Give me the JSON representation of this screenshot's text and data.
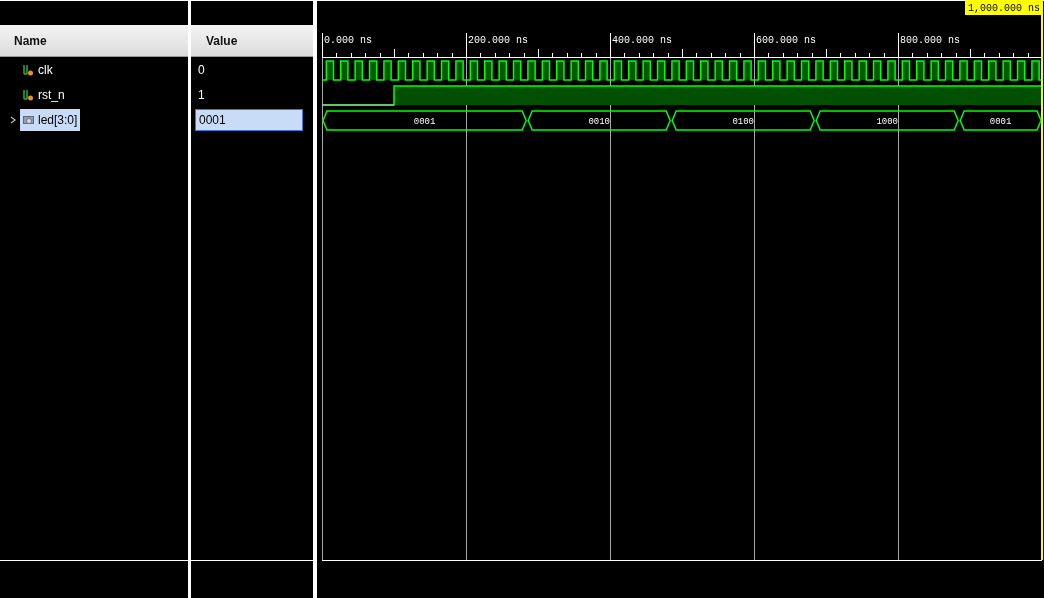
{
  "columns": [
    "Name",
    "Value"
  ],
  "ruler": {
    "labels": [
      "0.000 ns",
      "200.000 ns",
      "400.000 ns",
      "600.000 ns",
      "800.000 ns"
    ]
  },
  "cursor": {
    "label": "1,000.000 ns"
  },
  "signals": [
    {
      "name": "clk",
      "kind": "clock",
      "value": "0",
      "selected": false
    },
    {
      "name": "rst_n",
      "kind": "step",
      "value": "1",
      "selected": false
    },
    {
      "name": "led[3:0]",
      "kind": "bus",
      "value": "0001",
      "selected": true,
      "expanded": false,
      "segments": [
        "0001",
        "0010",
        "0100",
        "1000",
        "0001"
      ]
    }
  ]
}
